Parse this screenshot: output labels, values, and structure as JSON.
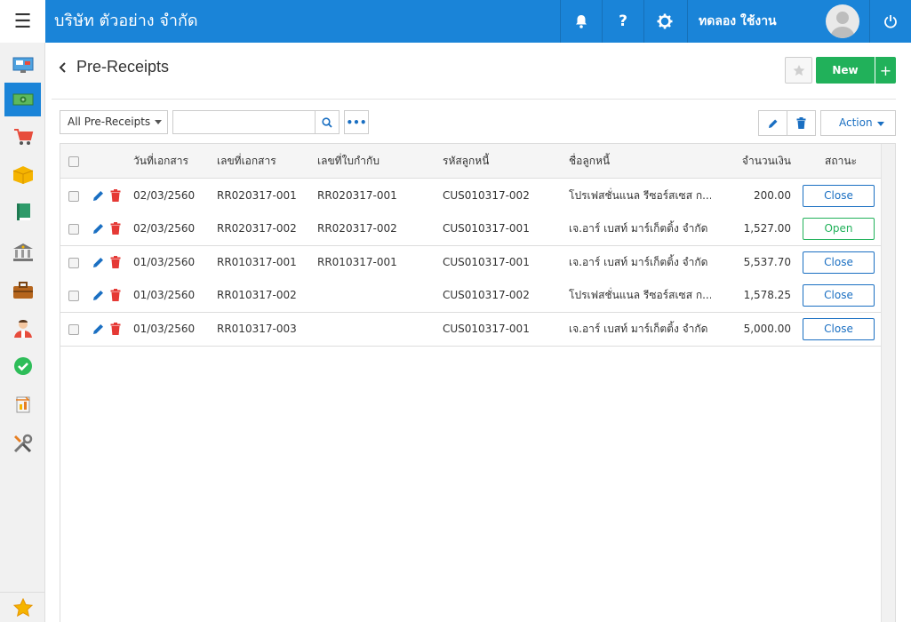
{
  "topbar": {
    "company": "บริษัท ตัวอย่าง จำกัด",
    "user_name": "ทดลอง ใช้งาน",
    "help_label": "?"
  },
  "sidebar": {
    "items": [
      {
        "icon": "dashboard-icon"
      },
      {
        "icon": "money-icon",
        "active": true
      },
      {
        "icon": "cart-icon"
      },
      {
        "icon": "box-icon"
      },
      {
        "icon": "book-icon"
      },
      {
        "icon": "bank-icon"
      },
      {
        "icon": "briefcase-icon"
      },
      {
        "icon": "person-icon"
      },
      {
        "icon": "check-icon"
      },
      {
        "icon": "report-icon"
      },
      {
        "icon": "tools-icon"
      }
    ],
    "favorite_icon": "star-icon"
  },
  "header": {
    "title": "Pre-Receipts",
    "new_label": "New",
    "plus_label": "+"
  },
  "toolbar": {
    "filter_value": "All Pre-Receipts",
    "search_value": "",
    "more_label": "•••",
    "action_label": "Action"
  },
  "table": {
    "columns": [
      "วันที่เอกสาร",
      "เลขที่เอกสาร",
      "เลขที่ใบกำกับ",
      "รหัสลูกหนี้",
      "ชื่อลูกหนี้",
      "จำนวนเงิน",
      "สถานะ"
    ],
    "rows": [
      {
        "date": "02/03/2560",
        "doc_no": "RR020317-001",
        "invoice_no": "RR020317-001",
        "customer_code": "CUS010317-002",
        "customer_name": "โปรเฟสชั่นแนล รีซอร์สเซส ก...",
        "amount": "200.00",
        "status": "Close"
      },
      {
        "date": "02/03/2560",
        "doc_no": "RR020317-002",
        "invoice_no": "RR020317-002",
        "customer_code": "CUS010317-001",
        "customer_name": "เจ.อาร์ เบสท์ มาร์เก็ตติ้ง จำกัด",
        "amount": "1,527.00",
        "status": "Open"
      },
      {
        "date": "01/03/2560",
        "doc_no": "RR010317-001",
        "invoice_no": "RR010317-001",
        "customer_code": "CUS010317-001",
        "customer_name": "เจ.อาร์ เบสท์ มาร์เก็ตติ้ง จำกัด",
        "amount": "5,537.70",
        "status": "Close"
      },
      {
        "date": "01/03/2560",
        "doc_no": "RR010317-002",
        "invoice_no": "",
        "customer_code": "CUS010317-002",
        "customer_name": "โปรเฟสชั่นแนล รีซอร์สเซส ก...",
        "amount": "1,578.25",
        "status": "Close"
      },
      {
        "date": "01/03/2560",
        "doc_no": "RR010317-003",
        "invoice_no": "",
        "customer_code": "CUS010317-001",
        "customer_name": "เจ.อาร์ เบสท์ มาร์เก็ตติ้ง จำกัด",
        "amount": "5,000.00",
        "status": "Close"
      }
    ]
  },
  "colors": {
    "primary": "#1a84d8",
    "success": "#21b15a",
    "danger": "#e53935",
    "link": "#1a6fc2"
  }
}
